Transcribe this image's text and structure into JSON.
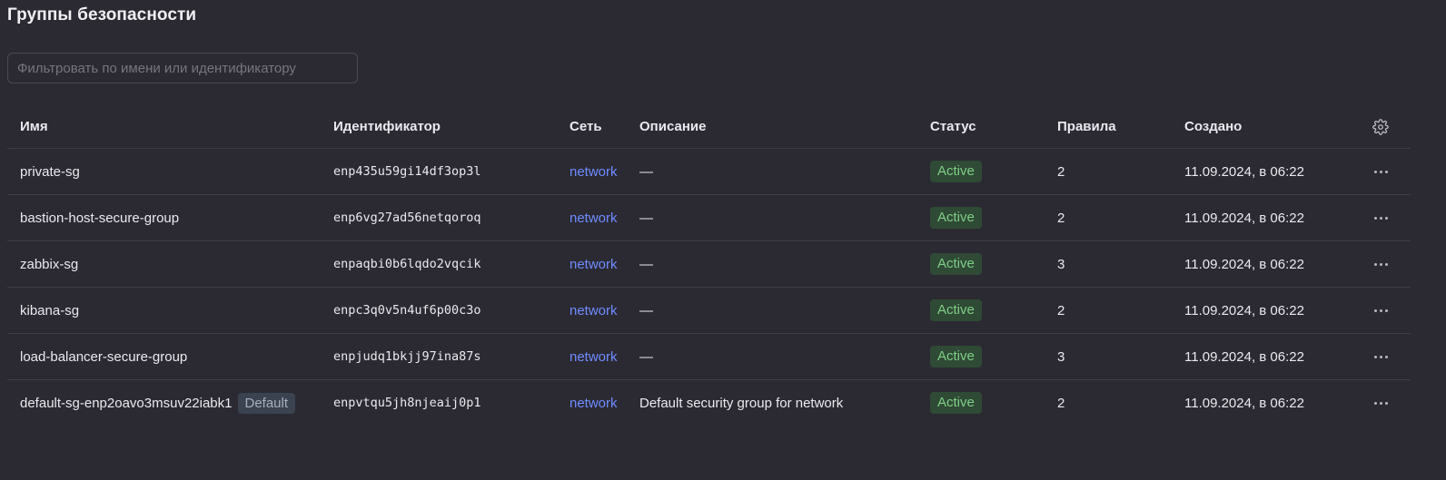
{
  "page": {
    "title": "Группы безопасности"
  },
  "filter": {
    "placeholder": "Фильтровать по имени или идентификатору",
    "value": ""
  },
  "table": {
    "headers": {
      "name": "Имя",
      "id": "Идентификатор",
      "network": "Сеть",
      "description": "Описание",
      "status": "Статус",
      "rules": "Правила",
      "created": "Создано"
    },
    "settings_icon": "gear-icon",
    "row_actions_icon": "more-horizontal-icon",
    "rows": [
      {
        "name": "private-sg",
        "default_badge": "",
        "id": "enp435u59gi14df3op3l",
        "network": "network",
        "description": "—",
        "status": "Active",
        "rules": "2",
        "created": "11.09.2024, в 06:22"
      },
      {
        "name": "bastion-host-secure-group",
        "default_badge": "",
        "id": "enp6vg27ad56netqoroq",
        "network": "network",
        "description": "—",
        "status": "Active",
        "rules": "2",
        "created": "11.09.2024, в 06:22"
      },
      {
        "name": "zabbix-sg",
        "default_badge": "",
        "id": "enpaqbi0b6lqdo2vqcik",
        "network": "network",
        "description": "—",
        "status": "Active",
        "rules": "3",
        "created": "11.09.2024, в 06:22"
      },
      {
        "name": "kibana-sg",
        "default_badge": "",
        "id": "enpc3q0v5n4uf6p00c3o",
        "network": "network",
        "description": "—",
        "status": "Active",
        "rules": "2",
        "created": "11.09.2024, в 06:22"
      },
      {
        "name": "load-balancer-secure-group",
        "default_badge": "",
        "id": "enpjudq1bkjj97ina87s",
        "network": "network",
        "description": "—",
        "status": "Active",
        "rules": "3",
        "created": "11.09.2024, в 06:22"
      },
      {
        "name": "default-sg-enp2oavo3msuv22iabk1",
        "default_badge": "Default",
        "id": "enpvtqu5jh8njeaij0p1",
        "network": "network",
        "description": "Default security group for network",
        "status": "Active",
        "rules": "2",
        "created": "11.09.2024, в 06:22"
      }
    ]
  },
  "colors": {
    "background": "#2b2a33",
    "link": "#6f8cff",
    "status_active_bg": "#2f4a35",
    "status_active_text": "#7fcf87",
    "default_badge_bg": "#3b4350",
    "default_badge_text": "#a7aebd"
  }
}
